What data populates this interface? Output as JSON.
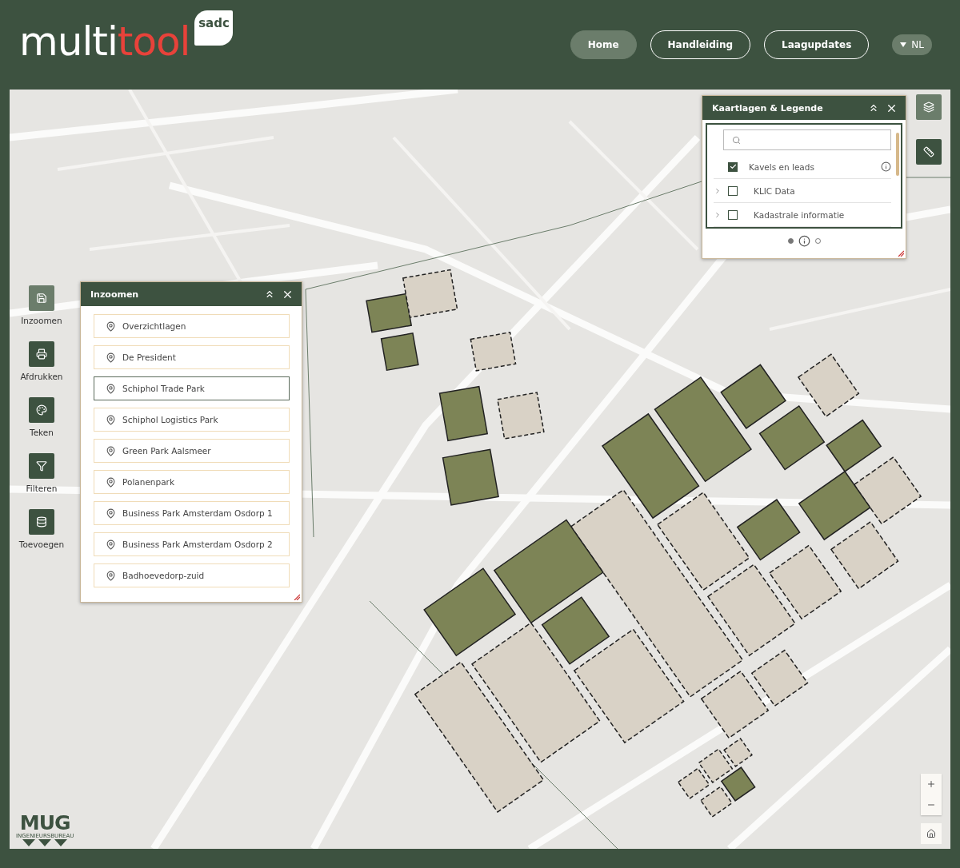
{
  "logo": {
    "prefix": "multi",
    "accent": "tool",
    "badge": "sadc"
  },
  "nav": [
    {
      "label": "Home",
      "selected": true
    },
    {
      "label": "Handleiding",
      "selected": false
    },
    {
      "label": "Laagupdates",
      "selected": false
    }
  ],
  "language": {
    "label": "NL"
  },
  "tools": [
    {
      "label": "Inzoomen",
      "selected": true
    },
    {
      "label": "Afdrukken",
      "selected": false
    },
    {
      "label": "Teken",
      "selected": false
    },
    {
      "label": "Filteren",
      "selected": false
    },
    {
      "label": "Toevoegen",
      "selected": false
    }
  ],
  "zoom_panel": {
    "title": "Inzoomen",
    "items": [
      {
        "label": "Overzichtlagen",
        "selected": false
      },
      {
        "label": "De President",
        "selected": false
      },
      {
        "label": "Schiphol Trade Park",
        "selected": true
      },
      {
        "label": "Schiphol Logistics Park",
        "selected": false
      },
      {
        "label": "Green Park Aalsmeer",
        "selected": false
      },
      {
        "label": "Polanenpark",
        "selected": false
      },
      {
        "label": "Business Park Amsterdam Osdorp 1",
        "selected": false
      },
      {
        "label": "Business Park Amsterdam Osdorp 2",
        "selected": false
      },
      {
        "label": "Badhoevedorp-zuid",
        "selected": false
      }
    ]
  },
  "layers_panel": {
    "title": "Kaartlagen & Legende",
    "layers": [
      {
        "label": "Kavels en leads",
        "checked": true,
        "expandable": false,
        "info": true
      },
      {
        "label": "KLIC Data",
        "checked": false,
        "expandable": true,
        "info": false
      },
      {
        "label": "Kadastrale informatie",
        "checked": false,
        "expandable": true,
        "info": false
      }
    ],
    "pages": [
      {
        "selected": true
      },
      {
        "selected": false
      }
    ]
  },
  "side_buttons": [
    {
      "selected": true
    },
    {
      "selected": false
    }
  ],
  "mug_logo": {
    "name": "MUG",
    "subtitle": "INGENIEURSBUREAU"
  }
}
